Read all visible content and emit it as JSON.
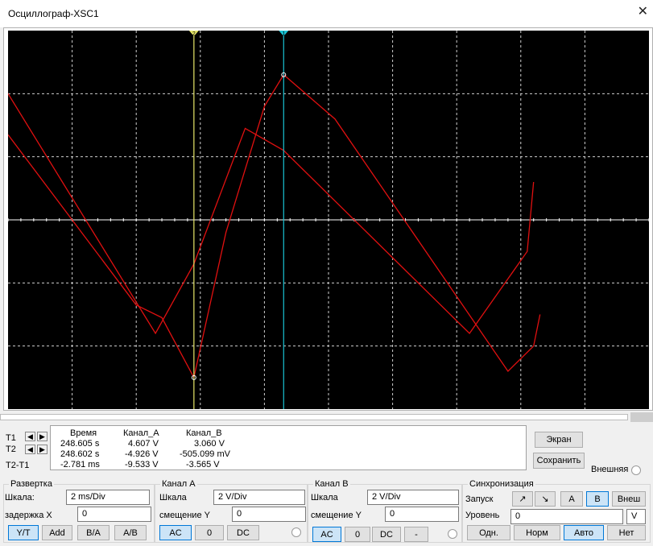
{
  "window": {
    "title": "Осциллограф-XSC1",
    "close_glyph": "✕"
  },
  "cursors": {
    "t1_marker": "1",
    "t2_marker": "2",
    "t1_label": "T1",
    "t2_label": "T2",
    "diff_label": "T2-T1"
  },
  "readout": {
    "headers": {
      "time": "Время",
      "channel_a": "Канал_A",
      "channel_b": "Канал_B"
    },
    "rows": [
      {
        "time": "248.605 s",
        "a": "4.607 V",
        "b": "3.060 V"
      },
      {
        "time": "248.602 s",
        "a": "-4.926 V",
        "b": "-505.099 mV"
      },
      {
        "time": "-2.781 ms",
        "a": "-9.533 V",
        "b": "-3.565 V"
      }
    ]
  },
  "side_buttons": {
    "screen": "Экран",
    "save": "Сохранить",
    "external": "Внешняя"
  },
  "timebase": {
    "title": "Развертка",
    "scale_label": "Шкала:",
    "scale_value": "2 ms/Div",
    "delay_label": "задержка X",
    "delay_value": "0",
    "modes": [
      "Y/T",
      "Add",
      "B/A",
      "A/B"
    ],
    "active_mode": "Y/T"
  },
  "channel_a": {
    "title": "Канал A",
    "scale_label": "Шкала",
    "scale_value": "2  V/Div",
    "offset_label": "смещение Y",
    "offset_value": "0",
    "coupling": [
      "AC",
      "0",
      "DC"
    ],
    "active": "AC"
  },
  "channel_b": {
    "title": "Канал B",
    "scale_label": "Шкала",
    "scale_value": "2  V/Div",
    "offset_label": "смещение Y",
    "offset_value": "0",
    "coupling": [
      "AC",
      "0",
      "DC",
      "-"
    ],
    "active": "AC"
  },
  "trigger": {
    "title": "Синхронизация",
    "start_label": "Запуск",
    "edge_rise": "↗",
    "edge_fall": "↘",
    "sources": [
      "A",
      "B",
      "Внеш"
    ],
    "active_source": "B",
    "level_label": "Уровень",
    "level_value": "0",
    "level_unit": "V",
    "modes": [
      "Одн.",
      "Норм",
      "Авто",
      "Нет"
    ],
    "active_mode": "Авто"
  },
  "colors": {
    "screen_bg": "#000000",
    "grid": "#cfcfcf",
    "trace": "#e01010",
    "cursor1": "#19c4d4",
    "cursor2": "#e8e86a",
    "accent": "#0078d7"
  },
  "chart_data": {
    "type": "line",
    "x_divisions": 10,
    "y_divisions": 6,
    "cursor_t1_div": 4.3,
    "cursor_t2_div": 2.9,
    "series": [
      {
        "values": [
          [
            0,
            2.0
          ],
          [
            2.3,
            -1.8
          ],
          [
            2.9,
            -0.7
          ],
          [
            3.7,
            1.45
          ],
          [
            4.3,
            1.1
          ],
          [
            7.2,
            -1.8
          ],
          [
            8.1,
            -0.5
          ],
          [
            8.2,
            0.6
          ]
        ]
      },
      {
        "values": [
          [
            0,
            1.35
          ],
          [
            2.0,
            -1.35
          ],
          [
            2.4,
            -1.55
          ],
          [
            2.9,
            -2.5
          ],
          [
            3.4,
            -0.2
          ],
          [
            4.0,
            1.8
          ],
          [
            4.3,
            2.3
          ],
          [
            5.1,
            1.6
          ],
          [
            7.8,
            -2.4
          ],
          [
            8.2,
            -2.0
          ],
          [
            8.3,
            -1.5
          ]
        ]
      }
    ]
  }
}
